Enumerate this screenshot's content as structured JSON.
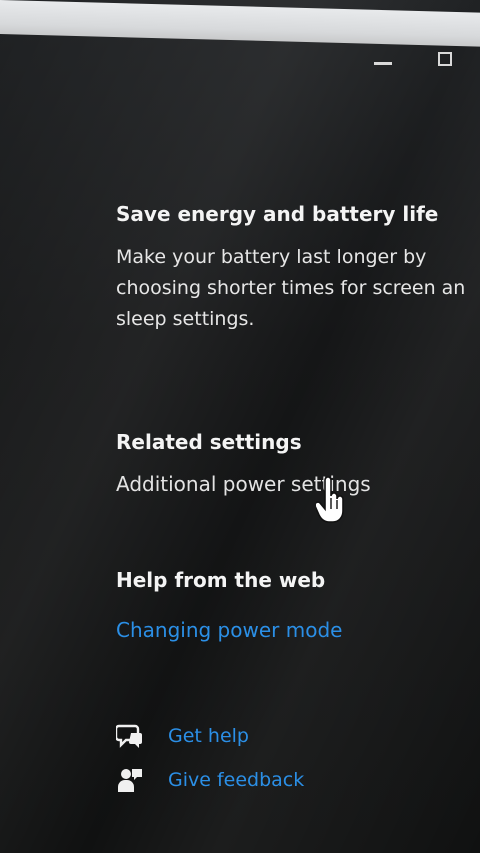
{
  "window": {
    "controls": {
      "minimize_icon": "minimize-icon",
      "maximize_icon": "maximize-icon"
    }
  },
  "energy": {
    "title": "Save energy and battery life",
    "description": "Make your battery last longer by\nchoosing shorter times for screen an\nsleep settings."
  },
  "related": {
    "title": "Related settings",
    "link": "Additional power settings"
  },
  "help_web": {
    "title": "Help from the web",
    "link": "Changing power mode"
  },
  "footer": {
    "get_help": {
      "label": "Get help",
      "icon": "chat-help-icon"
    },
    "give_feedback": {
      "label": "Give feedback",
      "icon": "feedback-person-icon"
    }
  },
  "colors": {
    "link_blue": "#2b8fe6",
    "background": "#151617",
    "text": "#f1f1f1"
  }
}
